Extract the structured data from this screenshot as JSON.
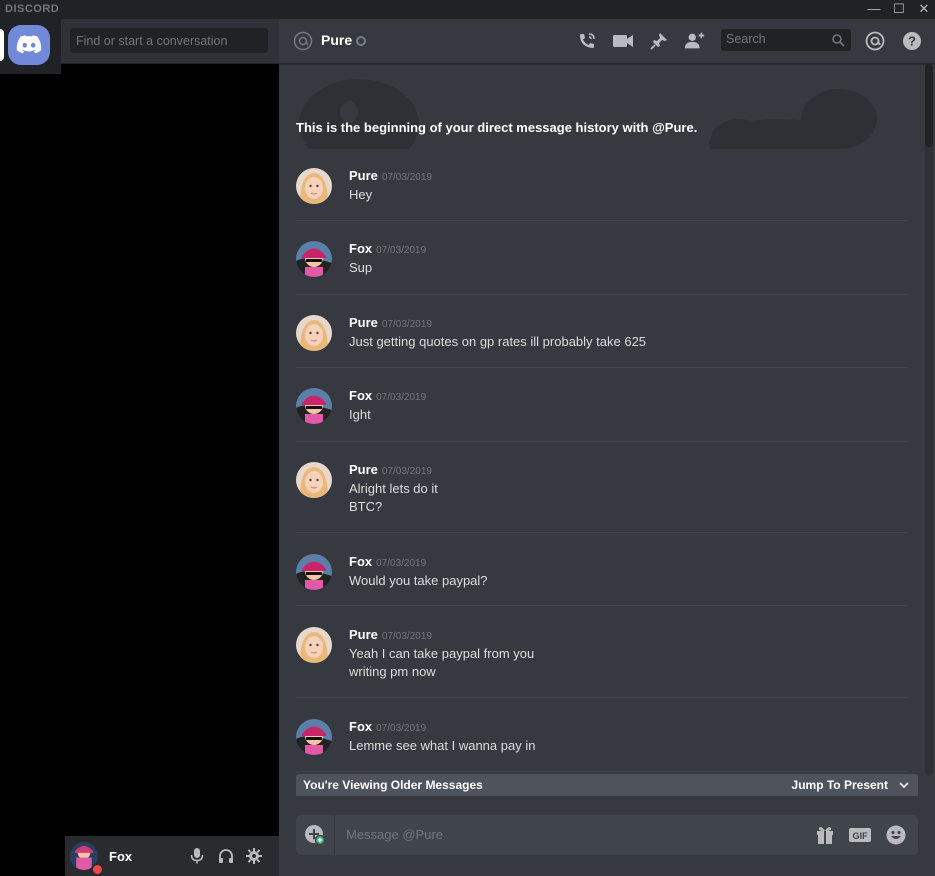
{
  "app": {
    "brand": "DISCORD"
  },
  "window": {
    "minimize": "—",
    "maximize": "☐",
    "close": "✕"
  },
  "dm_sidebar": {
    "search_placeholder": "Find or start a conversation"
  },
  "user_panel": {
    "name": "Fox",
    "status": "dnd"
  },
  "chat_header": {
    "name": "Pure",
    "search_placeholder": "Search"
  },
  "intro": {
    "prefix": "This is the beginning of your direct message history with ",
    "mention": "@Pure",
    "suffix": "."
  },
  "messages": [
    {
      "author": "Pure",
      "timestamp": "07/03/2019",
      "lines": [
        "Hey"
      ]
    },
    {
      "author": "Fox",
      "timestamp": "07/03/2019",
      "lines": [
        "Sup"
      ]
    },
    {
      "author": "Pure",
      "timestamp": "07/03/2019",
      "lines": [
        "Just getting quotes on gp rates ill probably take 625"
      ]
    },
    {
      "author": "Fox",
      "timestamp": "07/03/2019",
      "lines": [
        "Ight"
      ]
    },
    {
      "author": "Pure",
      "timestamp": "07/03/2019",
      "lines": [
        "Alright lets do it",
        "BTC?"
      ]
    },
    {
      "author": "Fox",
      "timestamp": "07/03/2019",
      "lines": [
        "Would you take paypal?"
      ]
    },
    {
      "author": "Pure",
      "timestamp": "07/03/2019",
      "lines": [
        "Yeah I can take paypal from you",
        "writing pm now"
      ]
    },
    {
      "author": "Fox",
      "timestamp": "07/03/2019",
      "lines": [
        "Lemme see what I wanna pay in"
      ]
    }
  ],
  "older_bar": {
    "label": "You're Viewing Older Messages",
    "jump": "Jump To Present"
  },
  "composer": {
    "placeholder": "Message @Pure",
    "gif_label": "GIF"
  },
  "colors": {
    "accent": "#7289da",
    "bg_main": "#36393f",
    "bg_sidebar": "#2f3136",
    "bg_tertiary": "#202225",
    "dnd": "#f04747",
    "online": "#43b581"
  }
}
